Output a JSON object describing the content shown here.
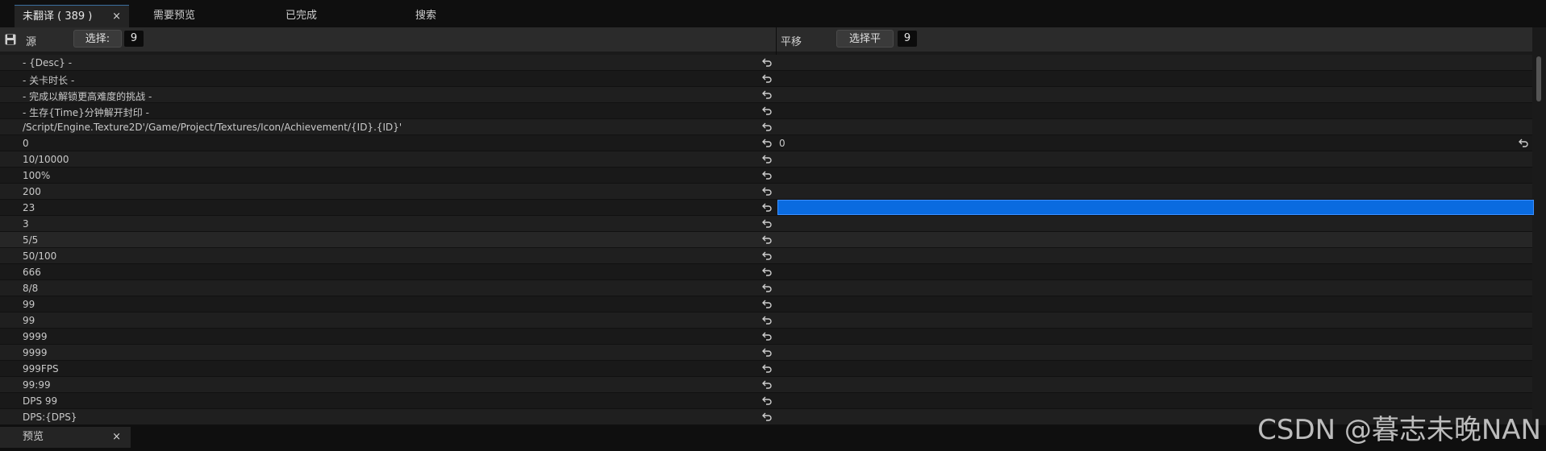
{
  "tabs": [
    {
      "label": "未翻译 ( 389 )",
      "close": "×"
    },
    {
      "label": "需要预览"
    },
    {
      "label": "已完成"
    },
    {
      "label": "搜索"
    }
  ],
  "header": {
    "source_label": "源",
    "source_select": "选择:",
    "source_count": "9",
    "target_label": "平移",
    "target_select": "选择平",
    "target_count": "9"
  },
  "rows": [
    {
      "source": "- {Desc} -",
      "target": ""
    },
    {
      "source": "- 关卡时长 -",
      "target": ""
    },
    {
      "source": "- 完成以解锁更高难度的挑战 -",
      "target": ""
    },
    {
      "source": "- 生存{Time}分钟解开封印 -",
      "target": ""
    },
    {
      "source": "/Script/Engine.Texture2D'/Game/Project/Textures/Icon/Achievement/{ID}.{ID}'",
      "target": ""
    },
    {
      "source": "0",
      "target": "0"
    },
    {
      "source": "10/10000",
      "target": ""
    },
    {
      "source": "100%",
      "target": ""
    },
    {
      "source": "200",
      "target": ""
    },
    {
      "source": "23",
      "target": ""
    },
    {
      "source": "3",
      "target": ""
    },
    {
      "source": "5/5",
      "target": ""
    },
    {
      "source": "50/100",
      "target": ""
    },
    {
      "source": "666",
      "target": ""
    },
    {
      "source": "8/8",
      "target": ""
    },
    {
      "source": "99",
      "target": ""
    },
    {
      "source": "99",
      "target": ""
    },
    {
      "source": "9999",
      "target": ""
    },
    {
      "source": "9999",
      "target": ""
    },
    {
      "source": "999FPS",
      "target": ""
    },
    {
      "source": "99:99",
      "target": ""
    },
    {
      "source": "DPS 99",
      "target": ""
    },
    {
      "source": "DPS:{DPS}",
      "target": ""
    }
  ],
  "bottom_tab": {
    "label": "预览",
    "close": "×"
  },
  "watermark": "CSDN @暮志未晚NAN",
  "colors": {
    "selection": "#0a6be0",
    "background": "#1a1a1a",
    "header": "#2b2b2b"
  }
}
